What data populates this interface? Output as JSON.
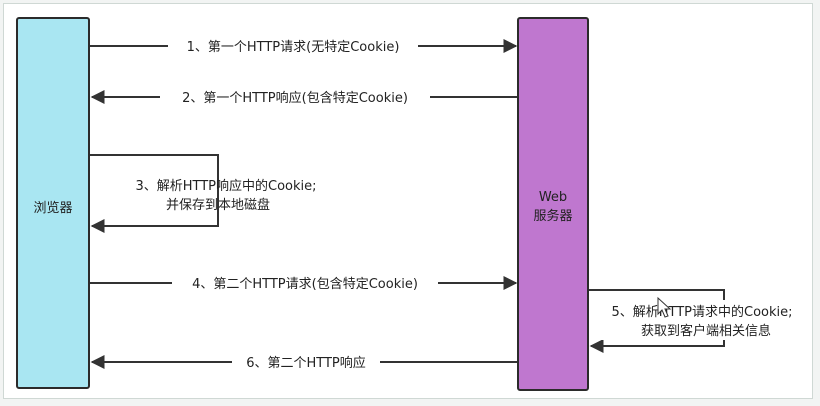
{
  "nodes": {
    "browser": {
      "label": "浏览器",
      "fill": "#a9e6f2",
      "stroke": "#2b2b2b"
    },
    "server": {
      "label_line1": "Web",
      "label_line2": "服务器",
      "fill": "#bf77cf",
      "stroke": "#2b2b2b"
    }
  },
  "steps": [
    {
      "label": "1、第一个HTTP请求(无特定Cookie)"
    },
    {
      "label": "2、第一个HTTP响应(包含特定Cookie)"
    },
    {
      "label_line1": "3、解析HTTP响应中的Cookie;",
      "label_line2": "并保存到本地磁盘"
    },
    {
      "label": "4、第二个HTTP请求(包含特定Cookie)"
    },
    {
      "label_line1": "5、解析HTTP请求中的Cookie;",
      "label_line2": "获取到客户端相关信息"
    },
    {
      "label": "6、第二个HTTP响应"
    }
  ],
  "colors": {
    "arrow": "#333333",
    "text": "#222222",
    "background": "#ffffff",
    "cursor": "#ffffff"
  },
  "icons": {
    "cursor": "mouse-pointer-icon"
  }
}
